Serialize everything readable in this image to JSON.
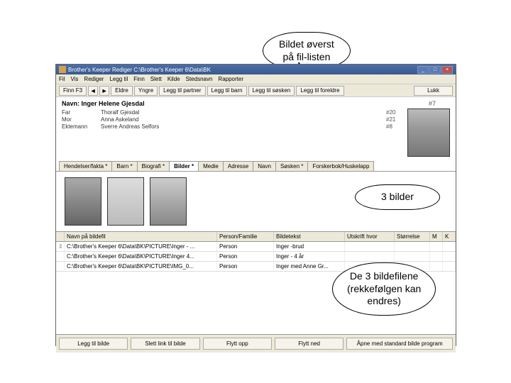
{
  "callouts": {
    "top": "Bildet øverst\npå fil-listen",
    "mid": "3 bilder",
    "bottom": "De 3 bildefilene\n(rekkefølgen kan\nendres)"
  },
  "titlebar": "Brother's Keeper Rediger   C:\\Brother's Keeper 6\\Data\\BK",
  "menubar": [
    "Fil",
    "Vis",
    "Rediger",
    "Legg til",
    "Finn",
    "Slett",
    "Kilde",
    "Stedsnavn",
    "Rapporter"
  ],
  "toolbar": {
    "find": "Finn F3",
    "eldre": "Eldre",
    "yngre": "Yngre",
    "legg_partner": "Legg til partner",
    "legg_barn": "Legg til barn",
    "legg_sosken": "Legg til søsken",
    "legg_foreldre": "Legg til foreldre",
    "lukk": "Lukk"
  },
  "person": {
    "name_label": "Navn:",
    "name": "Inger Helene Gjesdal",
    "id": "#7",
    "relations": [
      {
        "label": "Far",
        "value": "Thoralf Gjesdal",
        "id": "#20"
      },
      {
        "label": "Mor",
        "value": "Anna Askeland",
        "id": "#21"
      },
      {
        "label": "Ektemann",
        "value": "Sverre Andreas Selfors",
        "id": "#8"
      }
    ]
  },
  "tabs": [
    "Hendelser/fakta *",
    "Barn *",
    "Biografi *",
    "Bilder *",
    "Medie",
    "Adresse",
    "Navn",
    "Søsken *",
    "Forskerbok/Huskelapp"
  ],
  "active_tab": 3,
  "file_headers": {
    "navn": "Navn på bildefil",
    "pf": "Person/Familie",
    "tekst": "Bildetekst",
    "utskrift": "Utskrift hvor",
    "str": "Størrelse",
    "m": "M",
    "k": "K"
  },
  "files": [
    {
      "path": "C:\\Brother's Keeper 6\\Data\\BK\\PICTURE\\Inger - ...",
      "pf": "Person",
      "text": "Inger -brud"
    },
    {
      "path": "C:\\Brother's Keeper 6\\Data\\BK\\PICTURE\\Inger 4...",
      "pf": "Person",
      "text": "Inger - 4 år"
    },
    {
      "path": "C:\\Brother's Keeper 6\\Data\\BK\\PICTURE\\IMG_0...",
      "pf": "Person",
      "text": "Inger med Anne Gr..."
    }
  ],
  "bottom": {
    "legg": "Legg til bilde",
    "slett": "Slett link til bilde",
    "opp": "Flytt opp",
    "ned": "Flytt ned",
    "apne": "Åpne med standard bilde program"
  }
}
